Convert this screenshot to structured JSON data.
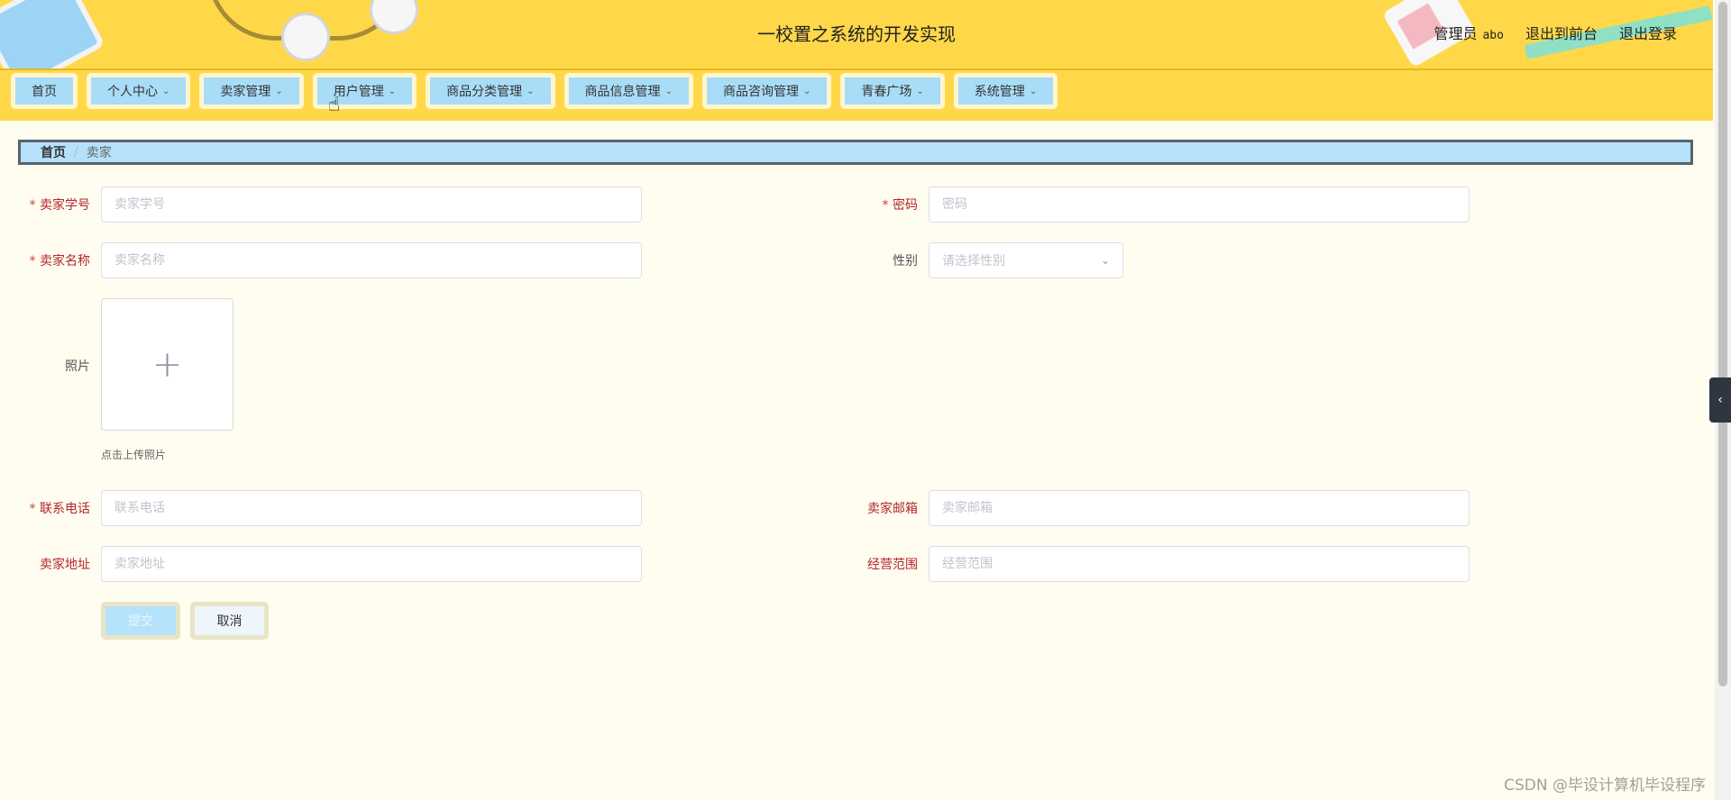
{
  "header": {
    "title": "一校置之系统的开发实现",
    "admin_role": "管理员",
    "admin_user": "abo",
    "to_front": "退出到前台",
    "logout": "退出登录"
  },
  "nav": {
    "items": [
      {
        "label": "首页",
        "has_dropdown": false
      },
      {
        "label": "个人中心",
        "has_dropdown": true
      },
      {
        "label": "卖家管理",
        "has_dropdown": true
      },
      {
        "label": "用户管理",
        "has_dropdown": true
      },
      {
        "label": "商品分类管理",
        "has_dropdown": true
      },
      {
        "label": "商品信息管理",
        "has_dropdown": true
      },
      {
        "label": "商品咨询管理",
        "has_dropdown": true
      },
      {
        "label": "青春广场",
        "has_dropdown": true
      },
      {
        "label": "系统管理",
        "has_dropdown": true
      }
    ]
  },
  "breadcrumb": {
    "home": "首页",
    "separator": "/",
    "current": "卖家"
  },
  "form": {
    "seller_no": {
      "label": "卖家学号",
      "placeholder": "卖家学号",
      "value": "",
      "required": true
    },
    "password": {
      "label": "密码",
      "placeholder": "密码",
      "value": "",
      "required": true
    },
    "seller_name": {
      "label": "卖家名称",
      "placeholder": "卖家名称",
      "value": "",
      "required": true
    },
    "gender": {
      "label": "性别",
      "placeholder": "请选择性别",
      "value": ""
    },
    "photo": {
      "label": "照片",
      "hint": "点击上传照片",
      "icon": "plus-icon"
    },
    "phone": {
      "label": "联系电话",
      "placeholder": "联系电话",
      "value": "",
      "required": true
    },
    "email": {
      "label": "卖家邮箱",
      "placeholder": "卖家邮箱",
      "value": ""
    },
    "address": {
      "label": "卖家地址",
      "placeholder": "卖家地址",
      "value": ""
    },
    "scope": {
      "label": "经营范围",
      "placeholder": "经营范围",
      "value": ""
    }
  },
  "buttons": {
    "submit": "提交",
    "cancel": "取消"
  },
  "watermark": "CSDN @毕设计算机毕设程序",
  "colors": {
    "header_bg": "#ffd84a",
    "nav_item_bg": "#a9dcf7",
    "breadcrumb_bg": "#b5e1fb",
    "required_star": "#d23c3c",
    "label_red": "#b3262b",
    "page_bg": "#fffdf0"
  }
}
